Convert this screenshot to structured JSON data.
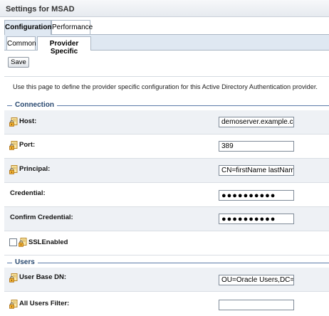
{
  "window": {
    "title": "Settings for MSAD"
  },
  "tabs": [
    {
      "label": "Configuration",
      "active": true
    },
    {
      "label": "Performance",
      "active": false
    }
  ],
  "sub_tabs": [
    {
      "label": "Common",
      "active": false
    },
    {
      "label": "Provider Specific",
      "active": true
    }
  ],
  "toolbar": {
    "save_label": "Save"
  },
  "intro": "Use this page to define the provider specific configuration for this Active Directory Authentication provider.",
  "sections": {
    "connection": {
      "label": "Connection"
    },
    "users": {
      "label": "Users"
    }
  },
  "fields": {
    "host": {
      "label": "Host:",
      "value": "demoserver.example.com"
    },
    "port": {
      "label": "Port:",
      "value": "389"
    },
    "principal": {
      "label": "Principal:",
      "value": "CN=firstName lastName,"
    },
    "credential": {
      "label": "Credential:",
      "value": "●●●●●●●●●●"
    },
    "confirm_credential": {
      "label": "Confirm Credential:",
      "value": "●●●●●●●●●●"
    },
    "ssl_enabled": {
      "label": "SSLEnabled",
      "checked": false
    },
    "user_base_dn": {
      "label": "User Base DN:",
      "value": "OU=Oracle Users,DC=h"
    },
    "all_users_filter": {
      "label": "All Users Filter:",
      "value": ""
    }
  },
  "colors": {
    "accent": "#27476f",
    "tab_bg": "#dfe8f2",
    "row_shade": "#eef1f5"
  },
  "icons": {
    "field_icon": "lock-document-icon"
  }
}
